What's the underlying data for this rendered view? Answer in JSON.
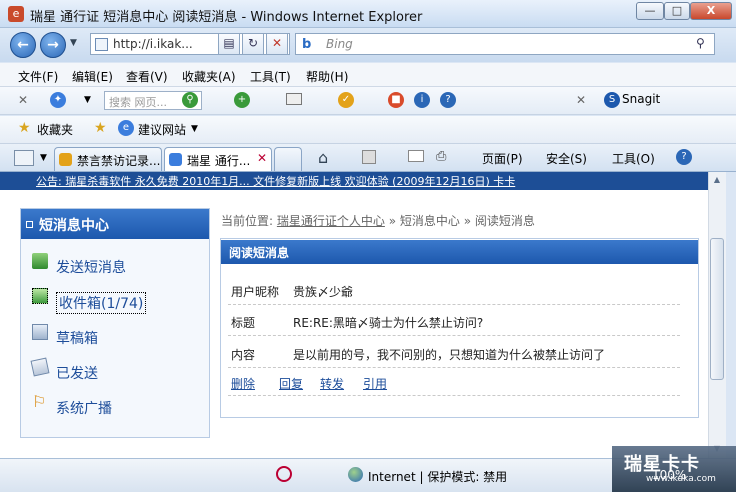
{
  "window": {
    "title": "瑞星 通行证 短消息中心 阅读短消息 - Windows Internet Explorer",
    "min": "—",
    "max": "□",
    "close": "X"
  },
  "nav": {
    "address": "http://i.ikak...",
    "search_placeholder": "Bing"
  },
  "menubar": [
    "文件(F)",
    "编辑(E)",
    "查看(V)",
    "收藏夹(A)",
    "工具(T)",
    "帮助(H)"
  ],
  "toolbar2": {
    "search_placeholder": "搜索 网页...",
    "snagit": "Snagit"
  },
  "favbar": {
    "favorites": "收藏夹",
    "suggested": "建议网站"
  },
  "tabs": [
    {
      "label": "禁言禁访记录..."
    },
    {
      "label": "瑞星 通行..."
    }
  ],
  "commands": {
    "page": "页面(P)",
    "safety": "安全(S)",
    "tools": "工具(O)"
  },
  "notice": "公告: 瑞星杀毒软件 永久免费 2010年1月... 文件修复新版上线 欢迎体验 (2009年12月16日)  卡卡",
  "sidebar": {
    "heading": "短消息中心",
    "items": [
      {
        "label": "发送短消息",
        "icon": "send-icon"
      },
      {
        "label": "收件箱(1/74)",
        "icon": "inbox-icon"
      },
      {
        "label": "草稿箱",
        "icon": "drafts-icon"
      },
      {
        "label": "已发送",
        "icon": "sent-icon"
      },
      {
        "label": "系统广播",
        "icon": "bell-icon"
      }
    ]
  },
  "breadcrumb": {
    "prefix": "当前位置:",
    "item1": "瑞星通行证个人中心",
    "sep": "»",
    "item2": "短消息中心",
    "item3": "阅读短消息"
  },
  "message": {
    "heading": "阅读短消息",
    "nickname_label": "用户昵称",
    "nickname": "贵族〆少爺",
    "subject_label": "标题",
    "subject": "RE:RE:黑暗〆骑士为什么禁止访问?",
    "content_label": "内容",
    "content": "是以前用的号，我不问别的，只想知道为什么被禁止访问了",
    "actions": [
      "删除",
      "回复",
      "转发",
      "引用"
    ]
  },
  "status": {
    "zone": "Internet | 保护模式: 禁用",
    "zoom": "100%"
  },
  "watermark": {
    "text": "瑞星卡卡",
    "sub": "www.ikaka.com"
  },
  "colors": {
    "accent": "#1d58ad",
    "link": "#1d4d9a"
  }
}
